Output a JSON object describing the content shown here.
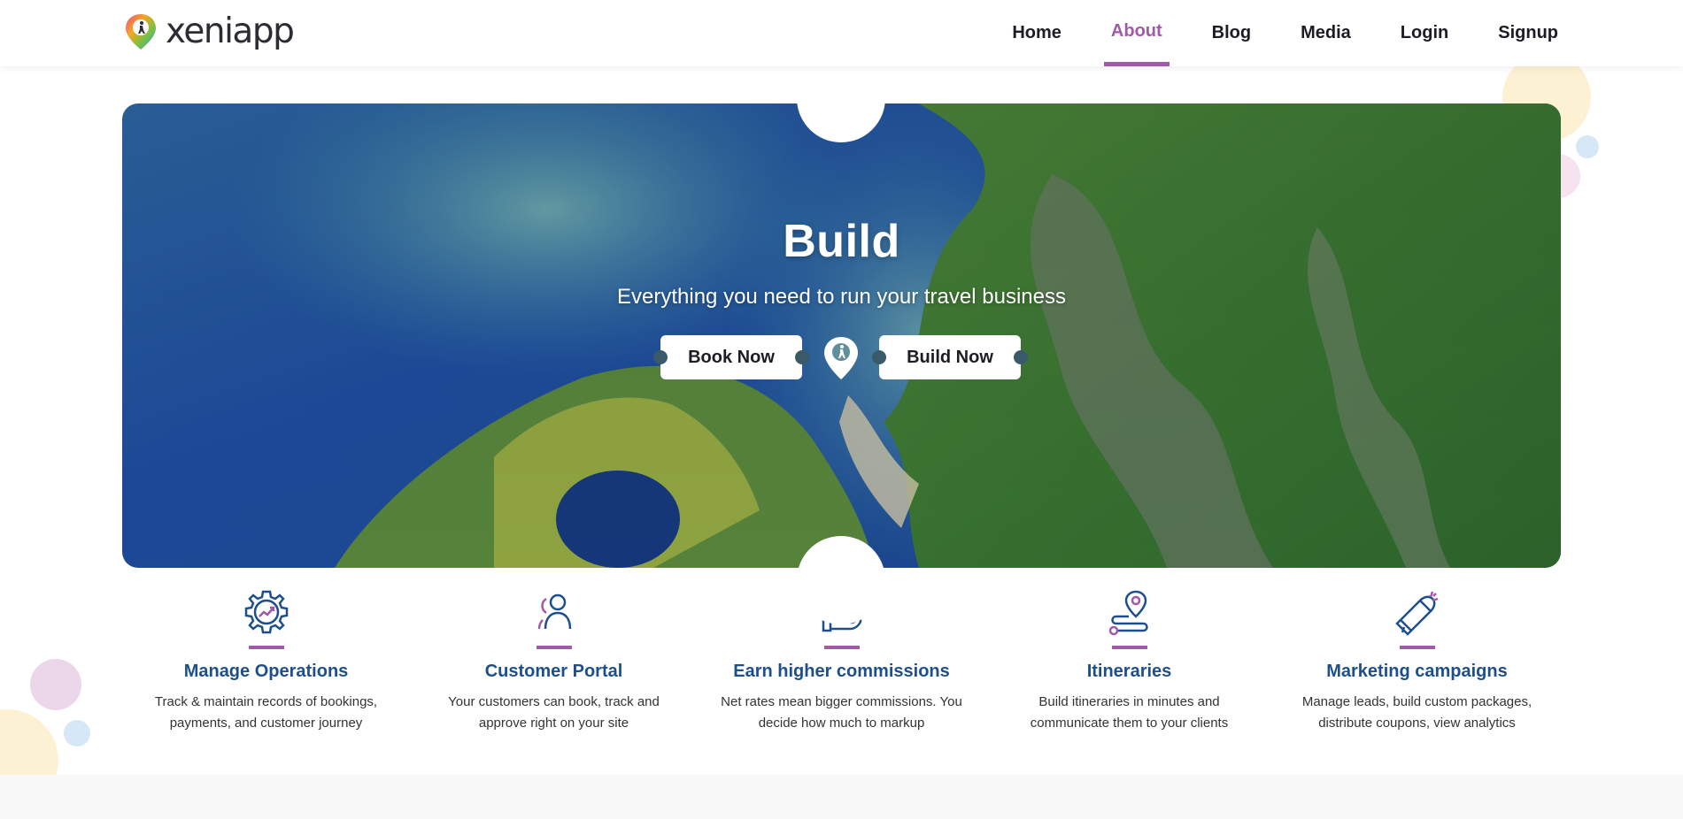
{
  "header": {
    "logo_text": "xeniapp",
    "nav": [
      {
        "label": "Home"
      },
      {
        "label": "About"
      },
      {
        "label": "Blog"
      },
      {
        "label": "Media"
      },
      {
        "label": "Login"
      },
      {
        "label": "Signup"
      }
    ],
    "active_nav": "About"
  },
  "hero": {
    "title": "Build",
    "subtitle": "Everything you need to run your travel business",
    "book_button": "Book Now",
    "build_button": "Build Now"
  },
  "features": [
    {
      "icon": "gear-chart-icon",
      "title": "Manage Operations",
      "description": "Track & maintain records of bookings, payments, and customer journey"
    },
    {
      "icon": "user-icon",
      "title": "Customer Portal",
      "description": "Your customers can book, track and approve right on your site"
    },
    {
      "icon": "hand-money-icon",
      "title": "Earn higher commissions",
      "description": "Net rates mean bigger commissions. You decide how much to markup"
    },
    {
      "icon": "map-route-icon",
      "title": "Itineraries",
      "description": "Build itineraries in minutes and communicate them to your clients"
    },
    {
      "icon": "megaphone-icon",
      "title": "Marketing campaigns",
      "description": "Manage leads, build custom packages, distribute coupons, view analytics"
    }
  ],
  "colors": {
    "accent": "#a05ba7",
    "feature_title": "#1d4f8c"
  }
}
